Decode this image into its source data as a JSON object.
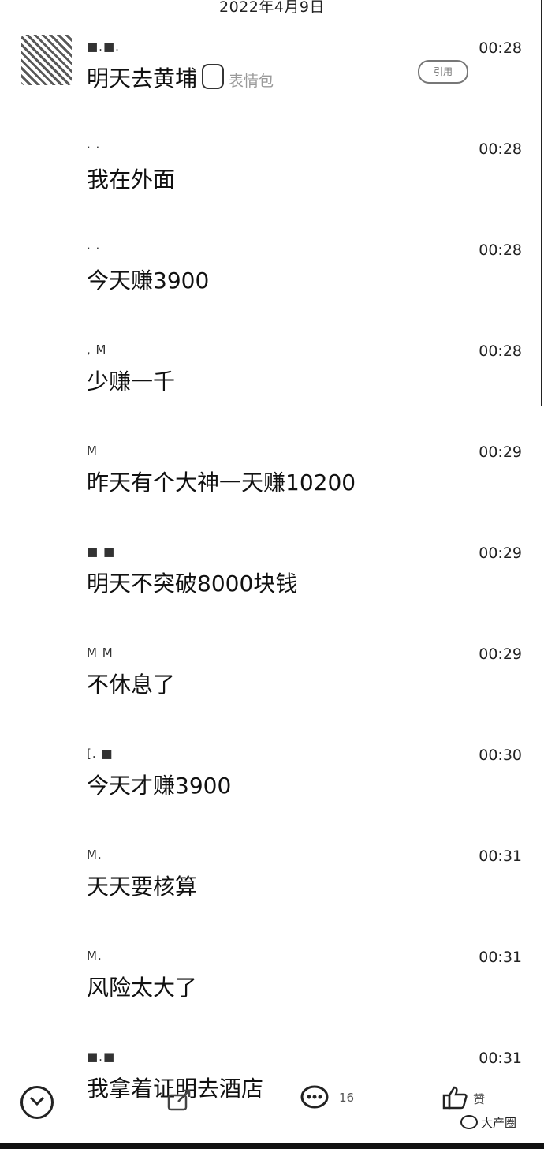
{
  "date_header": "2022年4月9日",
  "messages": [
    {
      "sender": "■.■.",
      "time": "00:28",
      "text": "明天去黄埔",
      "suffix": "表情包",
      "pill": "引用"
    },
    {
      "sender": "· ·",
      "time": "00:28",
      "text": "我在外面"
    },
    {
      "sender": "· ·",
      "time": "00:28",
      "text": "今天赚3900"
    },
    {
      "sender": ", M",
      "time": "00:28",
      "text": "少赚一千"
    },
    {
      "sender": "M",
      "time": "00:29",
      "text": "昨天有个大神一天赚10200"
    },
    {
      "sender": "■ ■",
      "time": "00:29",
      "text": "明天不突破8000块钱"
    },
    {
      "sender": "M M",
      "time": "00:29",
      "text": "不休息了"
    },
    {
      "sender": "[. ■",
      "time": "00:30",
      "text": "今天才赚3900"
    },
    {
      "sender": "M.",
      "time": "00:31",
      "text": "天天要核算"
    },
    {
      "sender": "M.",
      "time": "00:31",
      "text": "风险太大了"
    },
    {
      "sender": "■.■",
      "time": "00:31",
      "text": "我拿着证明去酒店"
    }
  ],
  "bottom_bar": {
    "comment_count": "16",
    "like_count": "赞",
    "watermark": "大产圈"
  },
  "icons": {
    "collapse": "chevron-down-icon",
    "share": "share-icon",
    "comment": "comment-icon",
    "like": "thumbs-up-icon",
    "watermark": "wechat-icon"
  }
}
